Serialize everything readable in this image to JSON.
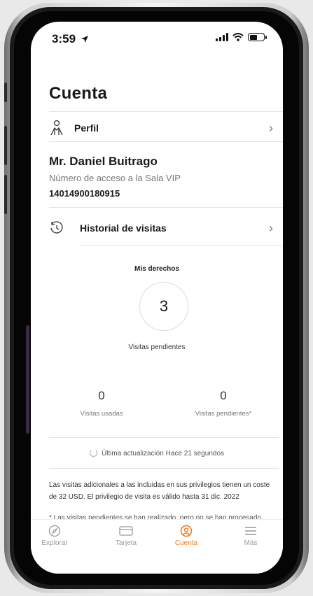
{
  "status_bar": {
    "time": "3:59",
    "location_icon": "location-arrow-icon"
  },
  "page": {
    "title": "Cuenta"
  },
  "profile_row": {
    "label": "Perfil",
    "icon": "person-icon"
  },
  "member": {
    "name": "Mr. Daniel Buitrago",
    "access_label": "Número de acceso a la Sala VIP",
    "access_number": "14014900180915"
  },
  "history_row": {
    "label": "Historial de visitas",
    "icon": "history-icon"
  },
  "rights": {
    "title": "Mis derechos",
    "count": "3",
    "subtitle": "Visitas pendientes"
  },
  "stats": [
    {
      "value": "0",
      "label": "Visitas usadas"
    },
    {
      "value": "0",
      "label": "Visitas pendientes*"
    }
  ],
  "update": {
    "text": "Última actualización Hace 21 segundos"
  },
  "notes": {
    "main": "Las visitas adicionales a las incluidas en sus privilegios tienen un coste de 32 USD. El privilegio de visita es válido hasta 31 dic. 2022",
    "footnote": "* Las visitas pendientes se han realizado, pero no se han procesado"
  },
  "tabs": [
    {
      "label": "Explorar",
      "icon": "compass-icon",
      "active": false
    },
    {
      "label": "Tarjeta",
      "icon": "card-icon",
      "active": false
    },
    {
      "label": "Cuenta",
      "icon": "account-icon",
      "active": true
    },
    {
      "label": "Más",
      "icon": "menu-icon",
      "active": false
    }
  ],
  "colors": {
    "accent": "#f07a1a",
    "text": "#1a1a1a",
    "muted": "#777777"
  }
}
